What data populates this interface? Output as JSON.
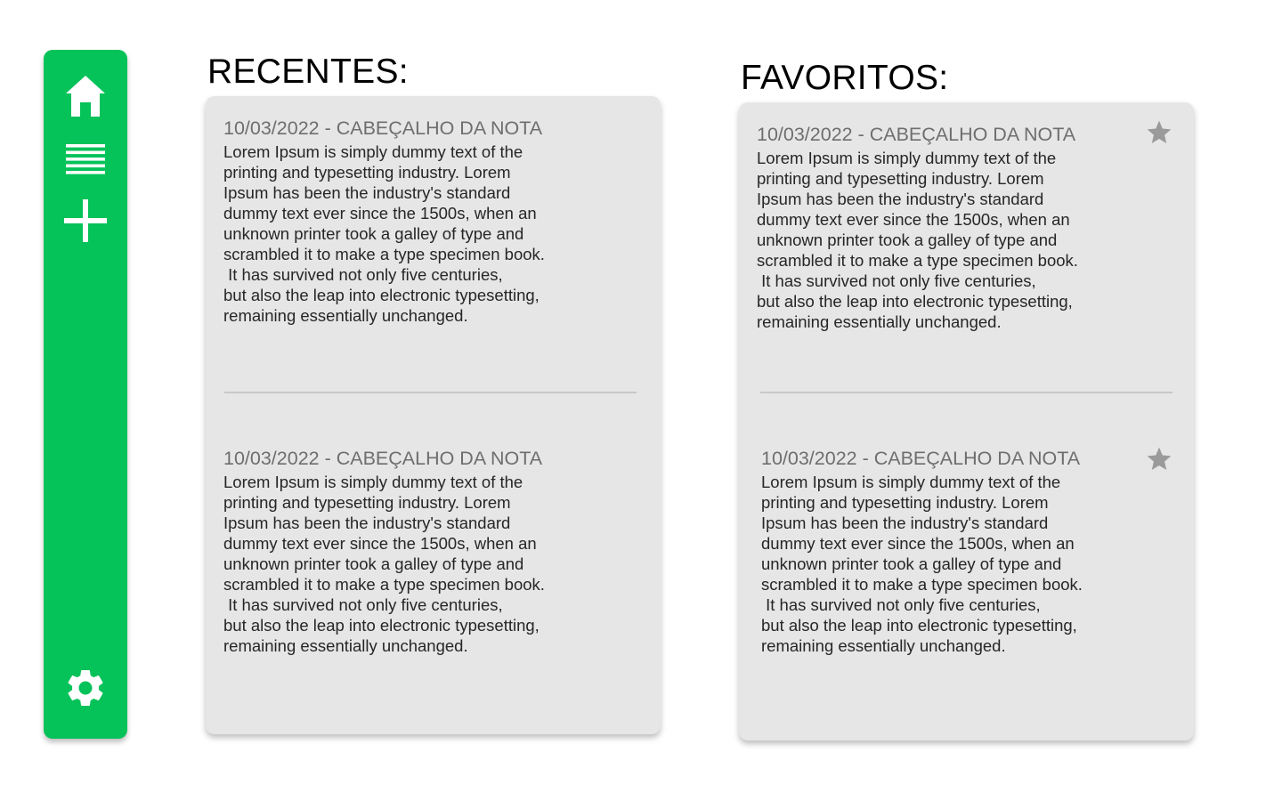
{
  "colors": {
    "sidebar": "#05c259",
    "panel": "#e6e6e6",
    "header_text": "#6e6e6e",
    "body_text": "#262626",
    "star": "#9a9a9a"
  },
  "sidebar": {
    "items": [
      {
        "icon": "home-icon"
      },
      {
        "icon": "list-icon"
      },
      {
        "icon": "plus-icon"
      },
      {
        "icon": "gear-icon"
      }
    ]
  },
  "recentes": {
    "title": "RECENTES:",
    "notes": [
      {
        "header": "10/03/2022 - CABEÇALHO DA NOTA",
        "body": "Lorem Ipsum is simply dummy text of the\nprinting and typesetting industry. Lorem\nIpsum has been the industry's standard\ndummy text ever since the 1500s, when an\nunknown printer took a galley of type and\nscrambled it to make a type specimen book.\n It has survived not only five centuries,\nbut also the leap into electronic typesetting,\nremaining essentially unchanged."
      },
      {
        "header": "10/03/2022 - CABEÇALHO DA NOTA",
        "body": "Lorem Ipsum is simply dummy text of the\nprinting and typesetting industry. Lorem\nIpsum has been the industry's standard\ndummy text ever since the 1500s, when an\nunknown printer took a galley of type and\nscrambled it to make a type specimen book.\n It has survived not only five centuries,\nbut also the leap into electronic typesetting,\nremaining essentially unchanged."
      }
    ]
  },
  "favoritos": {
    "title": "FAVORITOS:",
    "notes": [
      {
        "header": "10/03/2022 - CABEÇALHO DA NOTA",
        "body": "Lorem Ipsum is simply dummy text of the\nprinting and typesetting industry. Lorem\nIpsum has been the industry's standard\ndummy text ever since the 1500s, when an\nunknown printer took a galley of type and\nscrambled it to make a type specimen book.\n It has survived not only five centuries,\nbut also the leap into electronic typesetting,\nremaining essentially unchanged.",
        "icon": "star-icon"
      },
      {
        "header": "10/03/2022 - CABEÇALHO DA NOTA",
        "body": "Lorem Ipsum is simply dummy text of the\nprinting and typesetting industry. Lorem\nIpsum has been the industry's standard\ndummy text ever since the 1500s, when an\nunknown printer took a galley of type and\nscrambled it to make a type specimen book.\n It has survived not only five centuries,\nbut also the leap into electronic typesetting,\nremaining essentially unchanged.",
        "icon": "star-icon"
      }
    ]
  }
}
